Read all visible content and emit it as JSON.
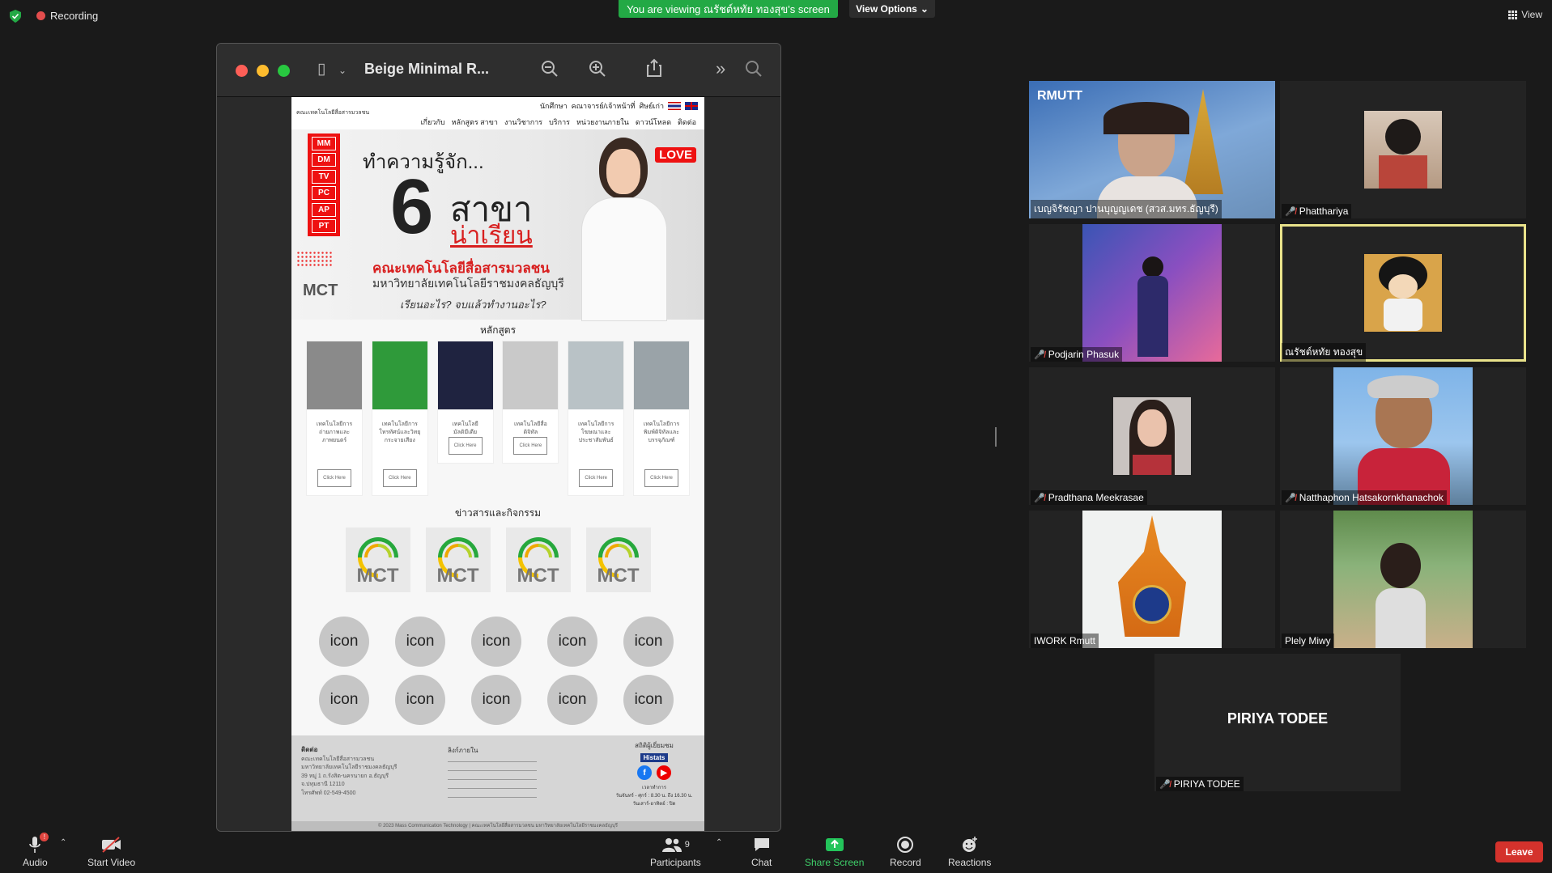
{
  "top": {
    "recording_label": "Recording",
    "viewing_banner": "You are viewing ณรัชต์หทัย ทองสุข's screen",
    "view_options_label": "View Options",
    "view_label": "View"
  },
  "window": {
    "title": "Beige Minimal R..."
  },
  "doc": {
    "org_name": "คณะเทคโนโลยีสื่อสารมวลชน",
    "nav1": [
      "นักศึกษา",
      "คณาจารย์/เจ้าหน้าที่",
      "ศิษย์เก่า"
    ],
    "nav2": [
      "เกี่ยวกับ",
      "หลักสูตร สาขา",
      "งานวิชาการ",
      "บริการ",
      "หน่วยงานภายใน",
      "ดาวน์โหลด",
      "ติดต่อ"
    ],
    "badges": [
      "MM",
      "DM",
      "TV",
      "PC",
      "AP",
      "PT"
    ],
    "hero": {
      "intro": "ทำความรู้จัก...",
      "six": "6",
      "sakha": "สาขา",
      "narian": "น่าเรียน",
      "faculty": "คณะเทคโนโลยีสื่อสารมวลชน",
      "university": "มหาวิทยาลัยเทคโนโลยีราชมงคลธัญบุรี",
      "question": "เรียนอะไร? จบแล้วทำงานอะไร?",
      "love": "LOVE",
      "logo": "MCT"
    },
    "courses_title": "หลักสูตร",
    "courses": [
      {
        "name": "เทคโนโลยีการถ่ายภาพและภาพยนตร์",
        "button": "Click Here",
        "color": "#8a8a8a"
      },
      {
        "name": "เทคโนโลยีการโทรทัศน์และวิทยุกระจายเสียง",
        "button": "Click Here",
        "color": "#2f9a3a"
      },
      {
        "name": "เทคโนโลยีมัลติมีเดีย",
        "button": "Click Here",
        "color": "#1f2340"
      },
      {
        "name": "เทคโนโลยีสื่อดิจิทัล",
        "button": "Click Here",
        "color": "#c9c9c9"
      },
      {
        "name": "เทคโนโลยีการโฆษณาและประชาสัมพันธ์",
        "button": "Click Here",
        "color": "#b9c2c6"
      },
      {
        "name": "เทคโนโลยีการพิมพ์ดิจิทัลและบรรจุภัณฑ์",
        "button": "Click Here",
        "color": "#9aa3a8"
      }
    ],
    "news_title": "ข่าวสารและกิจกรรม",
    "news_logos": [
      "MCT",
      "MCT",
      "MCT",
      "MCT"
    ],
    "icons": [
      "icon",
      "icon",
      "icon",
      "icon",
      "icon",
      "icon",
      "icon",
      "icon",
      "icon",
      "icon"
    ],
    "footer": {
      "contact_title": "ติดต่อ",
      "contact_lines": [
        "คณะเทคโนโลยีสื่อสารมวลชน",
        "มหาวิทยาลัยเทคโนโลยีราชมงคลธัญบุรี",
        "39 หมู่ 1 ถ.รังสิต-นครนายก อ.ธัญบุรี",
        "จ.ปทุมธานี 12110",
        "โทรศัพท์ 02-549-4500"
      ],
      "links_title": "ลิงก์ภายใน",
      "visitors_title": "สถิติผู้เยี่ยมชม",
      "histats": "Histats",
      "facebook": "f",
      "youtube": "▶",
      "hours_title": "เวลาทำการ",
      "hours": "วันจันทร์ - ศุกร์ : 8.30 น. ถึง 16.30 น.",
      "closed": "วันเสาร์-อาทิตย์ : ปิด",
      "copyright": "© 2023 Mass Communication Technology | คณะเทคโนโลยีสื่อสารมวลชน มหาวิทยาลัยเทคโนโลยีราชมงคลธัญบุรี"
    }
  },
  "participants": [
    {
      "name": "เบญจิรัชญา ปานบุญญเดช (สวส.มทร.ธัญบุรี)",
      "muted": false,
      "banner": "RMUTT"
    },
    {
      "name": "Phatthariya",
      "muted": true
    },
    {
      "name": "Podjarin Phasuk",
      "muted": true
    },
    {
      "name": "ณรัชต์หทัย ทองสุข",
      "muted": false
    },
    {
      "name": "Pradthana Meekrasae",
      "muted": true
    },
    {
      "name": "Natthaphon Hatsakornkhanachok",
      "muted": true
    },
    {
      "name": "IWORK Rmutt",
      "muted": false
    },
    {
      "name": "Plely Miwy",
      "muted": false
    },
    {
      "name": "PIRIYA TODEE",
      "muted": true,
      "big_name": "PIRIYA TODEE"
    }
  ],
  "toolbar": {
    "audio": "Audio",
    "audio_badge": "!",
    "start_video": "Start Video",
    "participants": "Participants",
    "participants_count": "9",
    "chat": "Chat",
    "share_screen": "Share Screen",
    "record": "Record",
    "reactions": "Reactions",
    "leave": "Leave"
  },
  "colors": {
    "accent_green": "#23a945",
    "leave_red": "#d4322c",
    "active_speaker": "#e9e28a"
  }
}
